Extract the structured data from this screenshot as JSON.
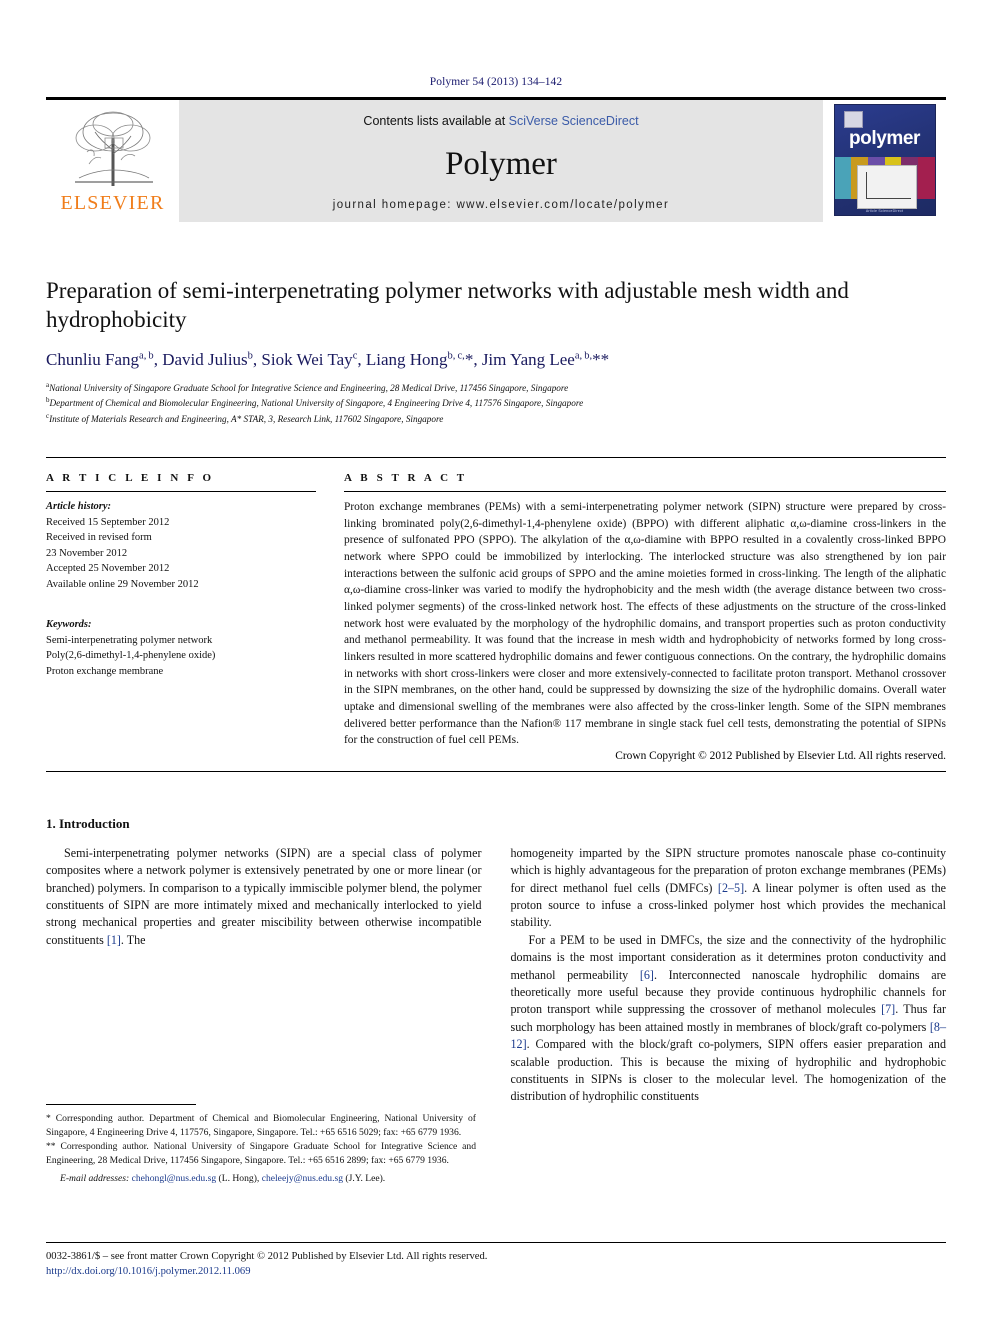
{
  "running_head": "Polymer 54 (2013) 134–142",
  "masthead": {
    "publisher_logo_name": "elsevier-tree-logo",
    "publisher_word": "ELSEVIER",
    "contents_prefix": "Contents lists available at ",
    "contents_link": "SciVerse ScienceDirect",
    "journal_name": "Polymer",
    "homepage": "journal homepage: www.elsevier.com/locate/polymer",
    "cover": {
      "title": "polymer",
      "footer": "Article ScienceDirect"
    }
  },
  "article": {
    "title": "Preparation of semi-interpenetrating polymer networks with adjustable mesh width and hydrophobicity",
    "authors_html": "Chunliu Fang<sup>a, b</sup>, David Julius<sup>b</sup>, Siok Wei Tay<sup>c</sup>, Liang Hong<sup>b, c,</sup>*, Jim Yang Lee<sup>a, b,</sup>**",
    "affiliations": [
      {
        "marker": "a",
        "text": "National University of Singapore Graduate School for Integrative Science and Engineering, 28 Medical Drive, 117456 Singapore, Singapore"
      },
      {
        "marker": "b",
        "text": "Department of Chemical and Biomolecular Engineering, National University of Singapore, 4 Engineering Drive 4, 117576 Singapore, Singapore"
      },
      {
        "marker": "c",
        "text": "Institute of Materials Research and Engineering, A* STAR, 3, Research Link, 117602 Singapore, Singapore"
      }
    ]
  },
  "article_info": {
    "heading": "A R T I C L E  I N F O",
    "history_label": "Article history:",
    "history": [
      "Received 15 September 2012",
      "Received in revised form",
      "23 November 2012",
      "Accepted 25 November 2012",
      "Available online 29 November 2012"
    ],
    "keywords_label": "Keywords:",
    "keywords": [
      "Semi-interpenetrating polymer network",
      "Poly(2,6-dimethyl-1,4-phenylene oxide)",
      "Proton exchange membrane"
    ]
  },
  "abstract": {
    "heading": "A B S T R A C T",
    "text": "Proton exchange membranes (PEMs) with a semi-interpenetrating polymer network (SIPN) structure were prepared by cross-linking brominated poly(2,6-dimethyl-1,4-phenylene oxide) (BPPO) with different aliphatic α,ω-diamine cross-linkers in the presence of sulfonated PPO (SPPO). The alkylation of the α,ω-diamine with BPPO resulted in a covalently cross-linked BPPO network where SPPO could be immobilized by interlocking. The interlocked structure was also strengthened by ion pair interactions between the sulfonic acid groups of SPPO and the amine moieties formed in cross-linking. The length of the aliphatic α,ω-diamine cross-linker was varied to modify the hydrophobicity and the mesh width (the average distance between two cross-linked polymer segments) of the cross-linked network host. The effects of these adjustments on the structure of the cross-linked network host were evaluated by the morphology of the hydrophilic domains, and transport properties such as proton conductivity and methanol permeability. It was found that the increase in mesh width and hydrophobicity of networks formed by long cross-linkers resulted in more scattered hydrophilic domains and fewer contiguous connections. On the contrary, the hydrophilic domains in networks with short cross-linkers were closer and more extensively-connected to facilitate proton transport. Methanol crossover in the SIPN membranes, on the other hand, could be suppressed by downsizing the size of the hydrophilic domains. Overall water uptake and dimensional swelling of the membranes were also affected by the cross-linker length. Some of the SIPN membranes delivered better performance than the Nafion® 117 membrane in single stack fuel cell tests, demonstrating the potential of SIPNs for the construction of fuel cell PEMs.",
    "copyright": "Crown Copyright © 2012 Published by Elsevier Ltd. All rights reserved."
  },
  "body": {
    "section_heading": "1. Introduction",
    "left_paragraphs": [
      "Semi-interpenetrating polymer networks (SIPN) are a special class of polymer composites where a network polymer is extensively penetrated by one or more linear (or branched) polymers. In comparison to a typically immiscible polymer blend, the polymer constituents of SIPN are more intimately mixed and mechanically interlocked to yield strong mechanical properties and greater miscibility between otherwise incompatible constituents [1]. The"
    ],
    "right_paragraphs": [
      "homogeneity imparted by the SIPN structure promotes nanoscale phase co-continuity which is highly advantageous for the preparation of proton exchange membranes (PEMs) for direct methanol fuel cells (DMFCs) [2–5]. A linear polymer is often used as the proton source to infuse a cross-linked polymer host which provides the mechanical stability.",
      "For a PEM to be used in DMFCs, the size and the connectivity of the hydrophilic domains is the most important consideration as it determines proton conductivity and methanol permeability [6]. Interconnected nanoscale hydrophilic domains are theoretically more useful because they provide continuous hydrophilic channels for proton transport while suppressing the crossover of methanol molecules [7]. Thus far such morphology has been attained mostly in membranes of block/graft co-polymers [8–12]. Compared with the block/graft co-polymers, SIPN offers easier preparation and scalable production. This is because the mixing of hydrophilic and hydrophobic constituents in SIPNs is closer to the molecular level. The homogenization of the distribution of hydrophilic constituents"
    ]
  },
  "footnotes": {
    "corresponding_1": "* Corresponding author. Department of Chemical and Biomolecular Engineering, National University of Singapore, 4 Engineering Drive 4, 117576, Singapore, Singapore. Tel.: +65 6516 5029; fax: +65 6779 1936.",
    "corresponding_2": "** Corresponding author. National University of Singapore Graduate School for Integrative Science and Engineering, 28 Medical Drive, 117456 Singapore, Singapore. Tel.: +65 6516 2899; fax: +65 6779 1936.",
    "email_label": "E-mail addresses:",
    "email_1": "chehongl@nus.edu.sg",
    "email_1_owner": "(L. Hong),",
    "email_2": "cheleejy@nus.edu.sg",
    "email_2_owner": "(J.Y. Lee)."
  },
  "page_footer": {
    "issn_line": "0032-3861/$ – see front matter Crown Copyright © 2012 Published by Elsevier Ltd. All rights reserved.",
    "doi": "http://dx.doi.org/10.1016/j.polymer.2012.11.069"
  },
  "colors": {
    "link_blue": "#1b3a8c",
    "elsevier_orange": "#F07D1A",
    "band_grey": "#e4e4e4",
    "cover_blue": "#2b3c8f"
  }
}
